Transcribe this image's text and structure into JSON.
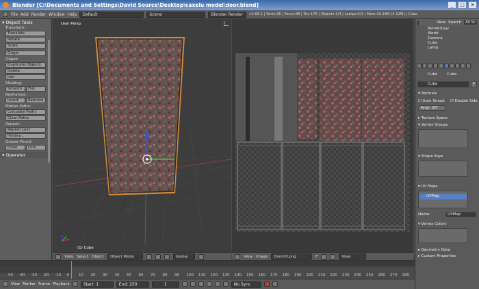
{
  "window": {
    "title": "Blender [C:\\Documents and Settings\\David Source\\Desktop\\caxelu model\\door.blend]"
  },
  "menu": {
    "items": [
      "File",
      "Add",
      "Render",
      "Window",
      "Help"
    ]
  },
  "screen_layout": "Default",
  "scene": "Scene",
  "render_engine": "Blender Render",
  "stats": "v2.66.1 | Verts:96 | Faces:88 | Tris:176 | Objects:1/3 | Lamps:0/1 | Mem:10.18M (4.12M) | Cube",
  "tools": {
    "header": "Object Tools",
    "transform_label": "Transform:",
    "translate": "Translate",
    "rotate": "Rotate",
    "scale": "Scale",
    "origin": "Origin",
    "object_label": "Object:",
    "duplicate": "Duplicate Objects",
    "delete": "Delete",
    "join": "Join",
    "shading_label": "Shading:",
    "smooth": "Smooth",
    "flat": "Flat",
    "keyframes_label": "Keyframes:",
    "insert": "Insert",
    "remove": "Remove",
    "motion_label": "Motion Paths:",
    "calc_paths": "Calculate Paths",
    "clear_paths": "Clear Paths",
    "repeat_label": "Repeat:",
    "repeat_last": "Repeat Last",
    "history": "History...",
    "grease_label": "Grease Pencil:",
    "draw": "Draw",
    "line": "Line",
    "operator": "Operator"
  },
  "viewport": {
    "label": "User Persp",
    "object_info": "(1) Cube",
    "header": {
      "view": "View",
      "select": "Select",
      "object": "Object",
      "mode": "Object Mode",
      "orientation": "Global"
    }
  },
  "uv_editor": {
    "header": {
      "view": "View",
      "image": "Image",
      "image_name": "DoorUV.png",
      "frame": "F",
      "view2": "View"
    }
  },
  "outliner": {
    "view": "View",
    "search": "Search",
    "all_scenes": "All Sc",
    "items": [
      "RenderLayi",
      "World",
      "Camera",
      "Cube",
      "Lamp"
    ]
  },
  "properties": {
    "breadcrumb_a": "Cube",
    "breadcrumb_b": "Cube",
    "name_field": "Cube",
    "f_btn": "F",
    "normals": "Normals",
    "auto_smooth": "Auto Smoot",
    "double_sided": "Double Side",
    "angle": "Angl: 30°",
    "texture_space": "Texture Space",
    "vertex_groups": "Vertex Groups",
    "shape_keys": "Shape Keys",
    "uv_maps": "UV Maps",
    "uvmap_item": "UVMap",
    "name_label": "Name:",
    "name_value": "UVMap",
    "vertex_colors": "Vertex Colors",
    "geometry_data": "Geometry Data",
    "custom_props": "Custom Properties"
  },
  "timeline": {
    "ticks": [
      "-50",
      "-40",
      "-30",
      "-20",
      "-10",
      "0",
      "10",
      "20",
      "30",
      "40",
      "50",
      "60",
      "70",
      "80",
      "90",
      "100",
      "110",
      "120",
      "130",
      "140",
      "150",
      "160",
      "170",
      "180",
      "190",
      "200",
      "210",
      "220",
      "230",
      "240",
      "250",
      "260",
      "270",
      "280"
    ],
    "view": "View",
    "marker": "Marker",
    "frame": "Frame",
    "playback": "Playback",
    "start": "Start: 1",
    "end": "End: 250",
    "current": "1",
    "sync": "No Sync"
  },
  "colors": {
    "accent": "#e88a2c",
    "selected": "#5680c2",
    "bg": "#4a4a4a"
  }
}
